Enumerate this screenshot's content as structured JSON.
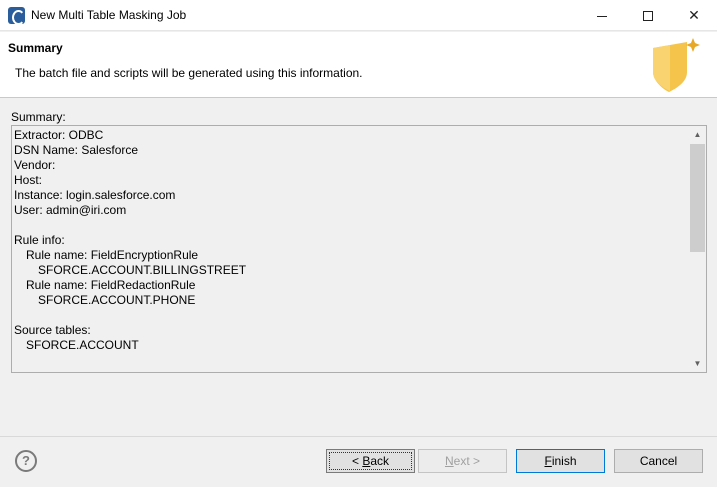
{
  "window": {
    "title": "New Multi Table Masking Job",
    "minimize_icon": "minimize-icon",
    "maximize_icon": "maximize-icon",
    "close_glyph": "✕"
  },
  "banner": {
    "title": "Summary",
    "description": "The batch file and scripts will be generated using this information."
  },
  "summary": {
    "label": "Summary:",
    "lines": [
      {
        "text": "Extractor: ODBC",
        "indent": 0
      },
      {
        "text": "DSN Name: Salesforce",
        "indent": 0
      },
      {
        "text": "Vendor:",
        "indent": 0
      },
      {
        "text": "Host:",
        "indent": 0
      },
      {
        "text": "Instance: login.salesforce.com",
        "indent": 0
      },
      {
        "text": "User: admin@iri.com",
        "indent": 0
      },
      {
        "text": "",
        "indent": 0
      },
      {
        "text": "Rule info:",
        "indent": 0
      },
      {
        "text": "Rule name: FieldEncryptionRule",
        "indent": 1
      },
      {
        "text": "SFORCE.ACCOUNT.BILLINGSTREET",
        "indent": 2
      },
      {
        "text": "Rule name: FieldRedactionRule",
        "indent": 1
      },
      {
        "text": "SFORCE.ACCOUNT.PHONE",
        "indent": 2
      },
      {
        "text": "",
        "indent": 0
      },
      {
        "text": "Source tables:",
        "indent": 0
      },
      {
        "text": "SFORCE.ACCOUNT",
        "indent": 1
      }
    ],
    "scroll_up_glyph": "▲",
    "scroll_down_glyph": "▼"
  },
  "footer": {
    "help_glyph": "?",
    "back_label": "< Back",
    "next_label": "Next >",
    "finish_label": "Finish",
    "cancel_label": "Cancel"
  },
  "colors": {
    "accent": "#0078d7",
    "banner_art": "#f5c44a"
  }
}
